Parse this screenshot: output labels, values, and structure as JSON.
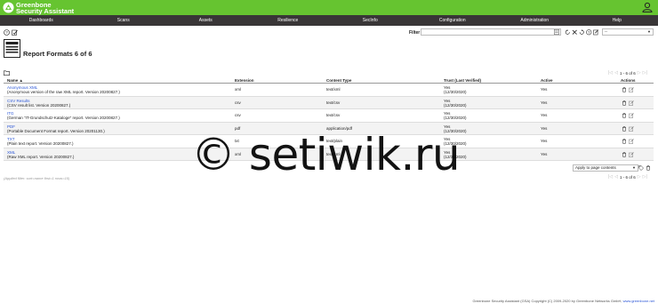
{
  "app": {
    "title_line1": "Greenbone",
    "title_line2": "Security Assistant"
  },
  "menu": [
    "Dashboards",
    "Scans",
    "Assets",
    "Resilience",
    "SecInfo",
    "Configuration",
    "Administration",
    "Help"
  ],
  "filter": {
    "label": "Filter",
    "value": "",
    "select_value": "--"
  },
  "page": {
    "title": "Report Formats 6 of 6"
  },
  "pager": {
    "text": "1 - 6 of 6"
  },
  "table": {
    "headers": {
      "name": "Name ▲",
      "extension": "Extension",
      "content_type": "Content Type",
      "trust": "Trust (Last Verified)",
      "active": "Active",
      "actions": "Actions"
    },
    "rows": [
      {
        "name": "Anonymous XML",
        "desc": "(Anonymous version of the raw XML report. Version 20200827.)",
        "extension": "xml",
        "content_type": "text/xml",
        "trust": "Yes",
        "trust_date": "(12/30/2020)",
        "active": "Yes"
      },
      {
        "name": "CSV Results",
        "desc": "(CSV result list. Version 20200827.)",
        "extension": "csv",
        "content_type": "text/csv",
        "trust": "Yes",
        "trust_date": "(12/30/2020)",
        "active": "Yes"
      },
      {
        "name": "ITG",
        "desc": "(German \"IT-Grundschutz-Kataloge\" report. Version 20200827.)",
        "extension": "csv",
        "content_type": "text/csv",
        "trust": "Yes",
        "trust_date": "(12/30/2020)",
        "active": "Yes"
      },
      {
        "name": "PDF",
        "desc": "(Portable Document Format report. Version 20201130.)",
        "extension": "pdf",
        "content_type": "application/pdf",
        "trust": "Yes",
        "trust_date": "(12/30/2020)",
        "active": "Yes"
      },
      {
        "name": "TXT",
        "desc": "(Plain text report. Version 20200827.)",
        "extension": "txt",
        "content_type": "text/plain",
        "trust": "Yes",
        "trust_date": "(12/30/2020)",
        "active": "Yes"
      },
      {
        "name": "XML",
        "desc": "(Raw XML report. Version 20200827.)",
        "extension": "xml",
        "content_type": "text/xml",
        "trust": "Yes",
        "trust_date": "(12/30/2020)",
        "active": "Yes"
      }
    ]
  },
  "bulk": {
    "apply_label": "Apply to page contents"
  },
  "applied_filter": "(Applied filter: sort=name first=1 rows=10)",
  "footer": {
    "text": "Greenbone Security Assistant (GSA) Copyright (C) 2009-2020 by Greenbone Networks GmbH,",
    "link": "www.greenbone.net"
  },
  "watermark": "© setiwik.ru",
  "colors": {
    "header_green": "#66c430",
    "menubar": "#393637",
    "link": "#2b56d6"
  }
}
